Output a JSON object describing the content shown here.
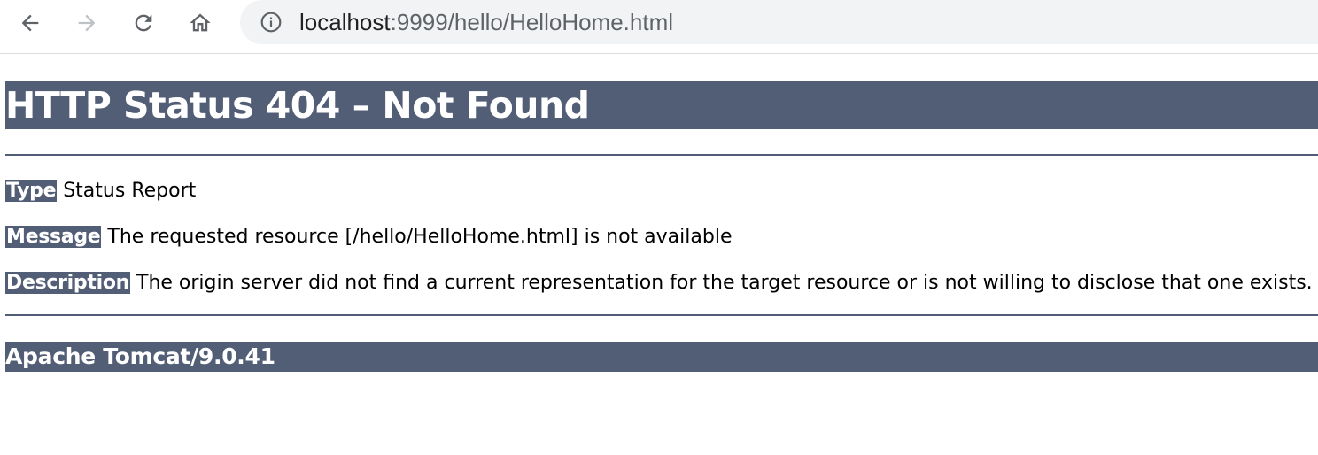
{
  "browser": {
    "toolbar": {
      "back_icon": "arrow-left-icon",
      "forward_icon": "arrow-right-icon",
      "reload_icon": "reload-icon",
      "home_icon": "home-icon"
    },
    "address_bar": {
      "info_icon": "info-icon",
      "url_host": "localhost",
      "url_rest": ":9999/hello/HelloHome.html"
    }
  },
  "page": {
    "title": "HTTP Status 404 – Not Found",
    "type": {
      "label": "Type",
      "value": "Status Report"
    },
    "message": {
      "label": "Message",
      "value": "The requested resource [/hello/HelloHome.html] is not available"
    },
    "description": {
      "label": "Description",
      "value": "The origin server did not find a current representation for the target resource or is not willing to disclose that one exists."
    },
    "footer": "Apache Tomcat/9.0.41"
  },
  "colors": {
    "header_bg": "#525d76",
    "header_text": "#ffffff",
    "omnibox_bg": "#f1f3f4"
  }
}
